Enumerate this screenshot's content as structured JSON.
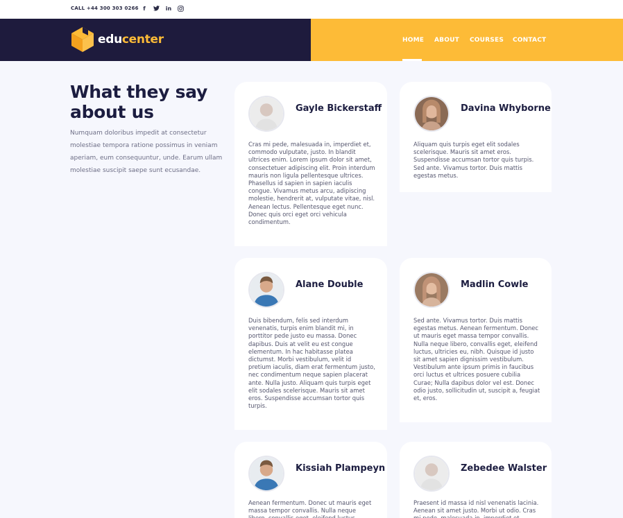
{
  "topbar": {
    "call": "CALL +44 300 303 0266",
    "social_icons": [
      "facebook-icon",
      "twitter-icon",
      "linkedin-icon",
      "instagram-icon"
    ]
  },
  "brand": {
    "part1": "edu",
    "part2": "center",
    "colors": {
      "dark": "#1e1b3d",
      "accent": "#fdbb37"
    }
  },
  "nav": {
    "items": [
      "HOME",
      "ABOUT",
      "COURSES",
      "CONTACT"
    ],
    "active": "HOME"
  },
  "intro": {
    "title": "What they say about us",
    "text": "Numquam doloribus impedit at consectetur molestiae tempora ratione possimus in veniam aperiam, eum consequuntur, unde. Earum ullam molestiae suscipit saepe sunt ecusandae."
  },
  "testimonials": [
    {
      "name": "Gayle Bickerstaff",
      "quote": "Cras mi pede, malesuada in, imperdiet et, commodo vulputate, justo. In blandit ultrices enim. Lorem ipsum dolor sit amet, consectetuer adipiscing elit. Proin interdum mauris non ligula pellentesque ultrices. Phasellus id sapien in sapien iaculis congue. Vivamus metus arcu, adipiscing molestie, hendrerit at, vulputate vitae, nisl. Aenean lectus. Pellentesque eget nunc. Donec quis orci eget orci vehicula condimentum."
    },
    {
      "name": "Davina Whyborne",
      "quote": "Aliquam quis turpis eget elit sodales scelerisque. Mauris sit amet eros. Suspendisse accumsan tortor quis turpis. Sed ante. Vivamus tortor. Duis mattis egestas metus."
    },
    {
      "name": "Alane Double",
      "quote": "Duis bibendum, felis sed interdum venenatis, turpis enim blandit mi, in porttitor pede justo eu massa. Donec dapibus. Duis at velit eu est congue elementum. In hac habitasse platea dictumst. Morbi vestibulum, velit id pretium iaculis, diam erat fermentum justo, nec condimentum neque sapien placerat ante. Nulla justo. Aliquam quis turpis eget elit sodales scelerisque. Mauris sit amet eros. Suspendisse accumsan tortor quis turpis."
    },
    {
      "name": "Madlin Cowle",
      "quote": "Sed ante. Vivamus tortor. Duis mattis egestas metus. Aenean fermentum. Donec ut mauris eget massa tempor convallis. Nulla neque libero, convallis eget, eleifend luctus, ultricies eu, nibh. Quisque id justo sit amet sapien dignissim vestibulum. Vestibulum ante ipsum primis in faucibus orci luctus et ultrices posuere cubilia Curae; Nulla dapibus dolor vel est. Donec odio justo, sollicitudin ut, suscipit a, feugiat et, eros."
    },
    {
      "name": "Kissiah Plampeyn",
      "quote": "Aenean fermentum. Donec ut mauris eget massa tempor convallis. Nulla neque libero, convallis eget, eleifend luctus, ultricies eu, nibh."
    },
    {
      "name": "Zebedee Walster",
      "quote": "Praesent id massa id nisl venenatis lacinia. Aenean sit amet justo. Morbi ut odio. Cras mi pede, malesuada in, imperdiet et, commodo vulputate."
    }
  ]
}
